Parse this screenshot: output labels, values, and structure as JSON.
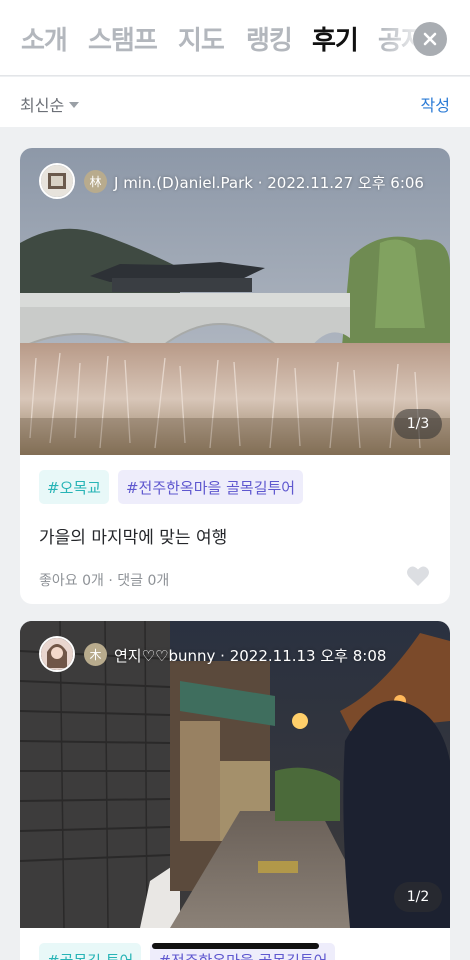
{
  "tabs": [
    {
      "label": "소개",
      "active": false
    },
    {
      "label": "스탬프",
      "active": false
    },
    {
      "label": "지도",
      "active": false
    },
    {
      "label": "랭킹",
      "active": false
    },
    {
      "label": "후기",
      "active": true
    },
    {
      "label": "공지",
      "active": false
    }
  ],
  "close_icon": "close-icon",
  "sort": {
    "label": "최신순",
    "icon": "caret-down-icon"
  },
  "write_label": "작성",
  "colors": {
    "accent": "#2b7bd6",
    "tag_mint": "#27b4b6",
    "tag_violet": "#5f58cf"
  },
  "posts": [
    {
      "badge": "林",
      "author_line": "J min.(D)aniel.Park  ·  2022.11.27 오후 6:06",
      "photo_counter": "1/3",
      "tags": [
        "#오목교",
        "#전주한옥마을 골목길투어"
      ],
      "title": "가을의 마지막에 맞는 여행",
      "meta": "좋아요 0개 · 댓글 0개",
      "like_icon": "heart-icon"
    },
    {
      "badge": "木",
      "author_line": "연지♡♡bunny  ·  2022.11.13 오후 8:08",
      "photo_counter": "1/2",
      "tags": [
        "#골목길 투어",
        "#전주한옥마을 골목길투어"
      ]
    }
  ]
}
